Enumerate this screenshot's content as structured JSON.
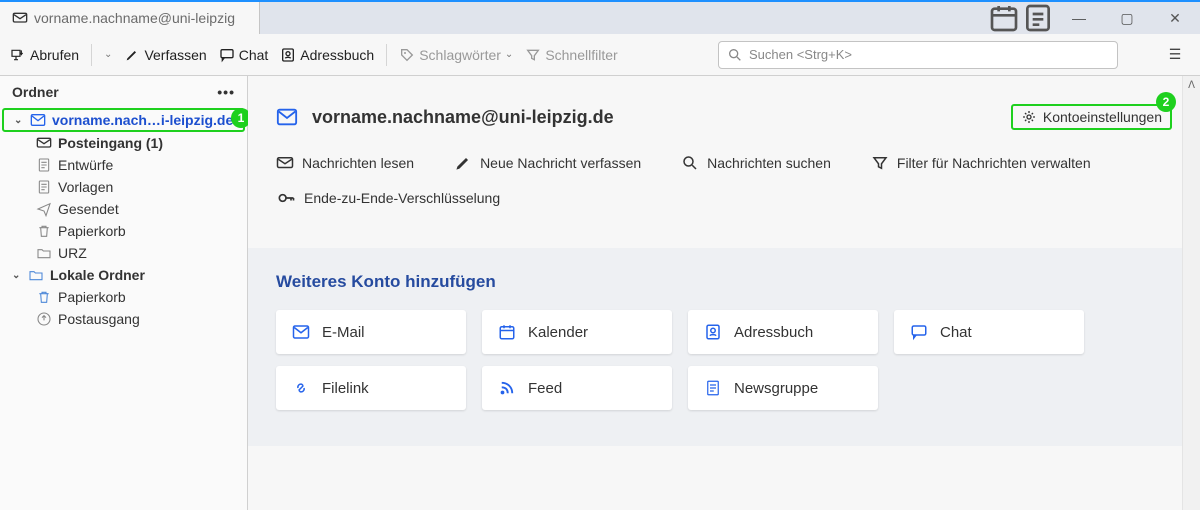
{
  "tab_title": "vorname.nachname@uni-leipzig",
  "toolbar": {
    "fetch": "Abrufen",
    "compose": "Verfassen",
    "chat": "Chat",
    "addressbook": "Adressbuch",
    "tags": "Schlagwörter",
    "quickfilter": "Schnellfilter",
    "search_placeholder": "Suchen <Strg+K>"
  },
  "sidebar": {
    "title": "Ordner",
    "badge1": "1",
    "account_display": "vorname.nach…i-leipzig.de",
    "folders": {
      "inbox": "Posteingang (1)",
      "drafts": "Entwürfe",
      "templates": "Vorlagen",
      "sent": "Gesendet",
      "trash": "Papierkorb",
      "urz": "URZ"
    },
    "local_label": "Lokale Ordner",
    "local": {
      "trash": "Papierkorb",
      "outbox": "Postausgang"
    }
  },
  "content": {
    "account_email": "vorname.nachname@uni-leipzig.de",
    "settings_label": "Kontoeinstellungen",
    "badge2": "2",
    "actions": {
      "read": "Nachrichten lesen",
      "compose": "Neue Nachricht verfassen",
      "search": "Nachrichten suchen",
      "filters": "Filter für Nachrichten verwalten"
    },
    "e2e": "Ende-zu-Ende-Verschlüsselung",
    "add_title": "Weiteres Konto hinzufügen",
    "cards": {
      "email": "E-Mail",
      "calendar": "Kalender",
      "addressbook": "Adressbuch",
      "chat": "Chat",
      "filelink": "Filelink",
      "feed": "Feed",
      "newsgroup": "Newsgruppe"
    }
  }
}
